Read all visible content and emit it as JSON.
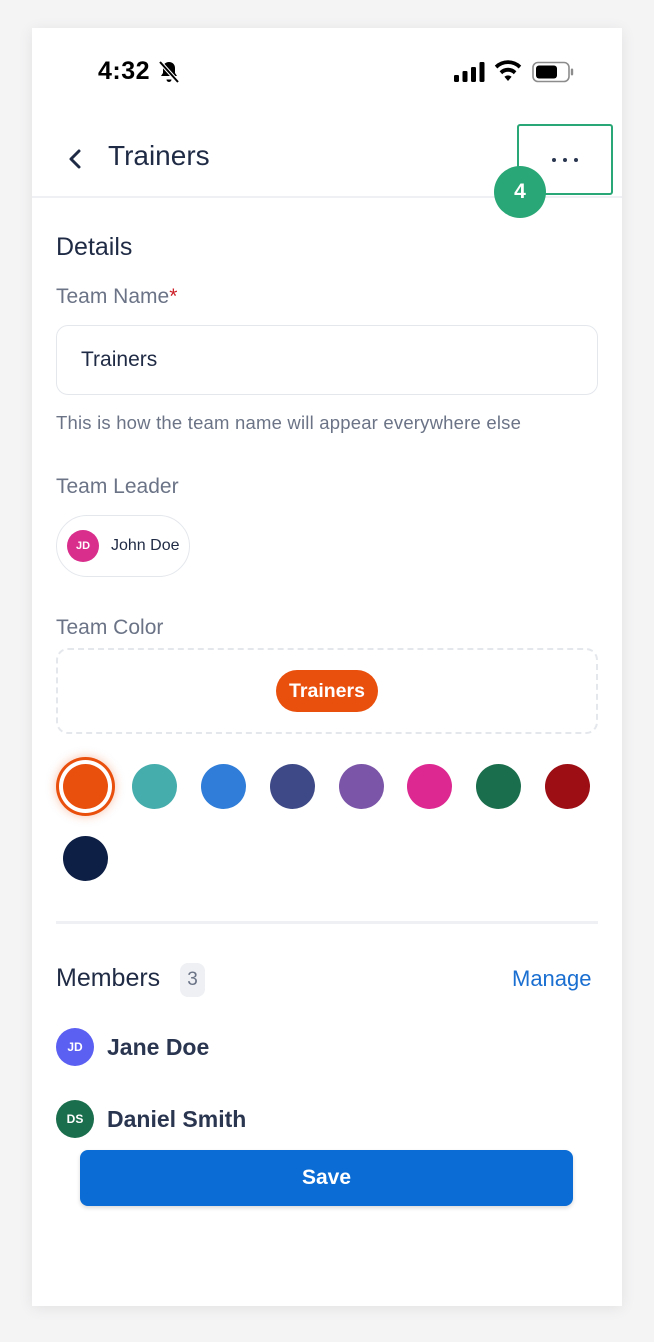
{
  "status_bar": {
    "time": "4:32",
    "icons": [
      "bell-slash-icon",
      "cellular-signal-icon",
      "wifi-icon",
      "battery-icon"
    ]
  },
  "header": {
    "back_icon": "chevron-left-icon",
    "title": "Trainers",
    "more_icon": "ellipsis-icon"
  },
  "annotation": {
    "step_number": "4",
    "color": "#2aa776"
  },
  "details": {
    "section_title": "Details",
    "team_name": {
      "label": "Team Name",
      "required_marker": "*",
      "value": "Trainers",
      "helper_text": "This is how the team name will appear everywhere else"
    },
    "team_leader": {
      "label": "Team Leader",
      "initials": "JD",
      "name": "John Doe",
      "avatar_color": "#d92e8c"
    },
    "team_color": {
      "label": "Team Color",
      "preview_label": "Trainers",
      "selected_color": "#e9500e",
      "swatches": [
        "#e9500e",
        "#45adac",
        "#2f7dd8",
        "#3e4a87",
        "#7b56a8",
        "#dc2890",
        "#1b6e4d",
        "#9c0e14",
        "#0d1f45"
      ]
    }
  },
  "members": {
    "title": "Members",
    "count": "3",
    "manage_label": "Manage",
    "list": [
      {
        "initials": "JD",
        "name": "Jane Doe",
        "avatar_color": "#5b5ff2"
      },
      {
        "initials": "DS",
        "name": "Daniel Smith",
        "avatar_color": "#1b6e4d"
      }
    ]
  },
  "footer": {
    "save_label": "Save",
    "accent": "#0a6cd4"
  }
}
